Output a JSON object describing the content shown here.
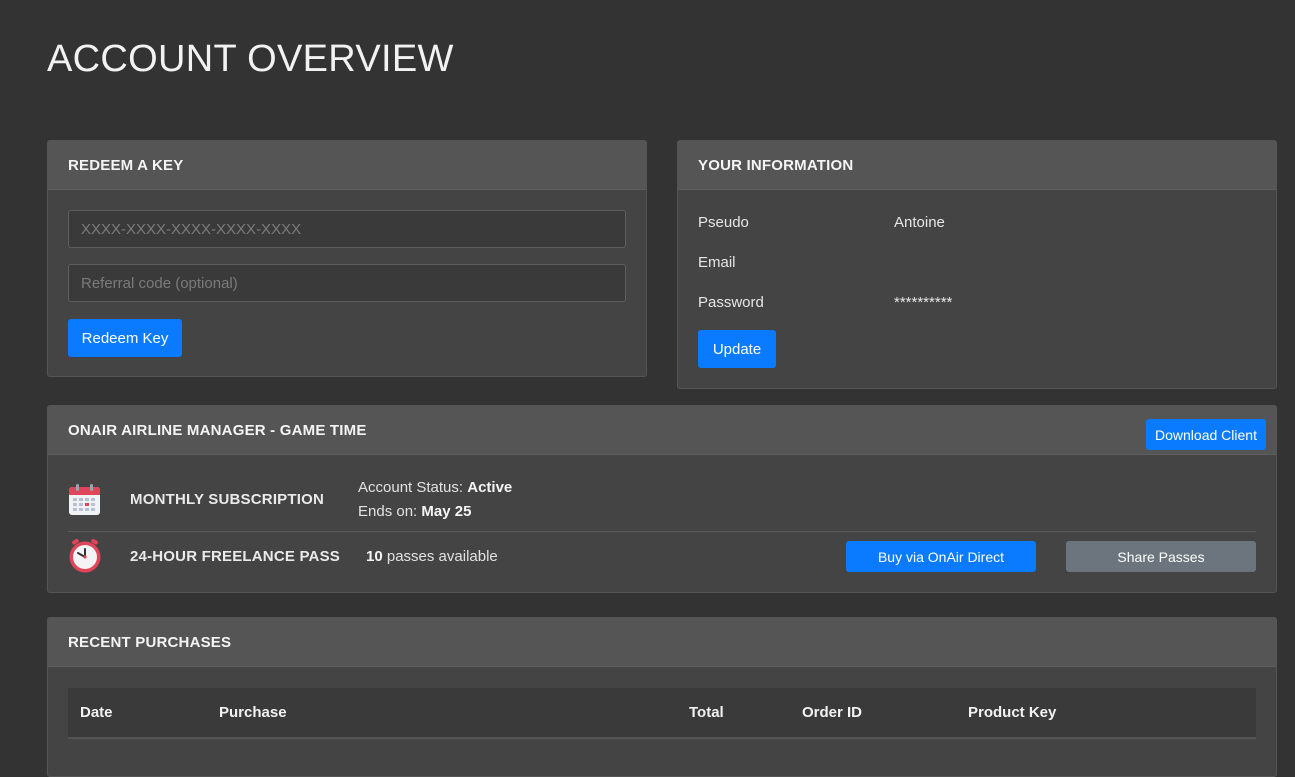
{
  "page": {
    "title": "ACCOUNT OVERVIEW"
  },
  "redeem": {
    "heading": "REDEEM A KEY",
    "key_placeholder": "XXXX-XXXX-XXXX-XXXX-XXXX",
    "referral_placeholder": "Referral code (optional)",
    "button": "Redeem Key"
  },
  "info": {
    "heading": "YOUR INFORMATION",
    "rows": [
      {
        "label": "Pseudo",
        "value": "Antoine"
      },
      {
        "label": "Email",
        "value": ""
      },
      {
        "label": "Password",
        "value": "**********"
      }
    ],
    "button": "Update"
  },
  "game_time": {
    "heading": "ONAIR AIRLINE MANAGER - GAME TIME",
    "download_button": "Download Client",
    "subscription": {
      "title": "MONTHLY SUBSCRIPTION",
      "icon": "calendar-icon",
      "status_label": "Account Status:",
      "status_value": "Active",
      "ends_label": "Ends on:",
      "ends_value": "May 25"
    },
    "freelance": {
      "title": "24-HOUR FREELANCE PASS",
      "icon": "clock-icon",
      "passes_count": "10",
      "passes_text": "passes available",
      "buy_button": "Buy via OnAir Direct",
      "share_button": "Share Passes"
    }
  },
  "purchases": {
    "heading": "RECENT PURCHASES",
    "columns": [
      "Date",
      "Purchase",
      "Total",
      "Order ID",
      "Product Key"
    ]
  },
  "colors": {
    "accent": "#0a7bff",
    "background": "#333333",
    "card": "#444444",
    "card_header": "#555555",
    "secondary": "#6c757d"
  }
}
